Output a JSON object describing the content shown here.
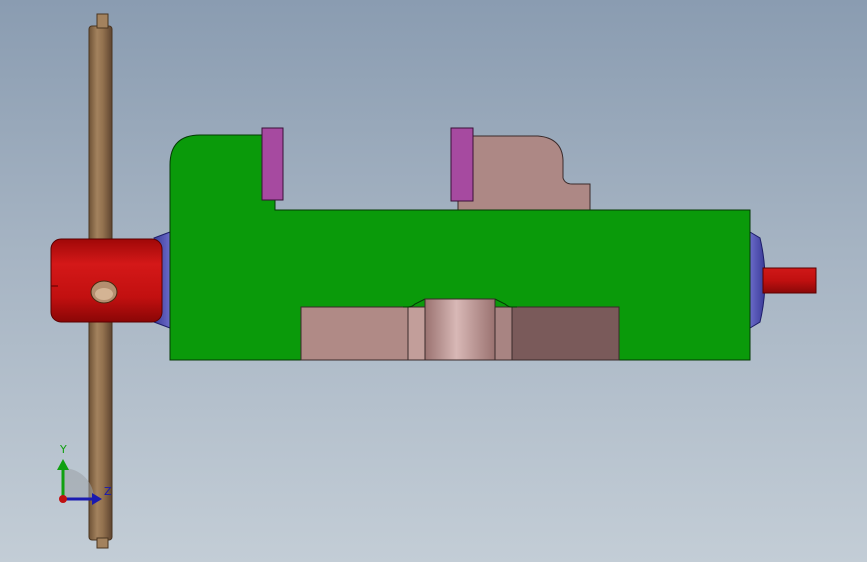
{
  "viewport": {
    "background_top": "#8a9cb1",
    "background_bottom": "#c3cdd6"
  },
  "model": {
    "parts": [
      {
        "name": "vise-body",
        "color": "#0a9a0a"
      },
      {
        "name": "fixed-jaw-plate",
        "color": "#a64aa0"
      },
      {
        "name": "movable-jaw-plate",
        "color": "#a64aa0"
      },
      {
        "name": "movable-jaw",
        "color": "#ad8885"
      },
      {
        "name": "guide-block",
        "color": "#b08a86"
      },
      {
        "name": "nut-bushing",
        "color": "#c2a09e"
      },
      {
        "name": "handle-bar",
        "color": "#8b6a4a"
      },
      {
        "name": "handle-hub",
        "color": "#c81010"
      },
      {
        "name": "lead-screw-end",
        "color": "#c81010"
      },
      {
        "name": "end-caps",
        "color": "#4a4aa8"
      }
    ]
  },
  "triad": {
    "y_label": "Y",
    "z_label": "Z",
    "y_color": "#10a010",
    "z_color": "#1a1ab0",
    "x_color": "#c01010"
  }
}
